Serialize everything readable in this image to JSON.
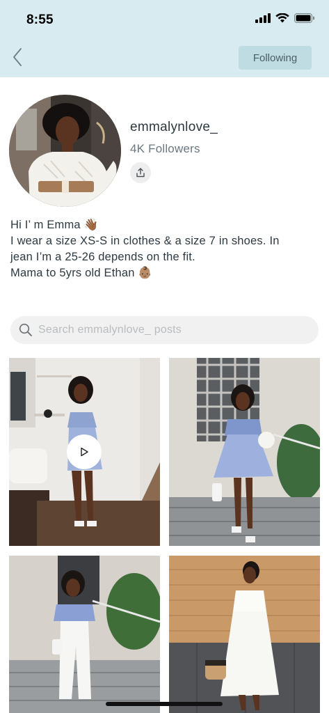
{
  "status_bar": {
    "time": "8:55"
  },
  "nav": {
    "following_label": "Following"
  },
  "profile": {
    "username": "emmalynlove_",
    "followers": "4K Followers",
    "bio_lines": [
      "Hi I’ m Emma 👋🏾",
      "I wear a size XS-S in clothes & a size 7 in shoes. In",
      "jean I’m a 25-26 depends on the fit.",
      "Mama to 5yrs old Ethan 👶🏽"
    ]
  },
  "search": {
    "placeholder": "Search emmalynlove_ posts",
    "value": ""
  },
  "posts": [
    {
      "name": "post-1",
      "has_video": true
    },
    {
      "name": "post-2",
      "has_video": false
    },
    {
      "name": "post-3",
      "has_video": false
    },
    {
      "name": "post-4",
      "has_video": false
    }
  ],
  "colors": {
    "header_bg": "#d7ebf1",
    "following_bg": "#bfdce3",
    "text": "#2d3940"
  }
}
